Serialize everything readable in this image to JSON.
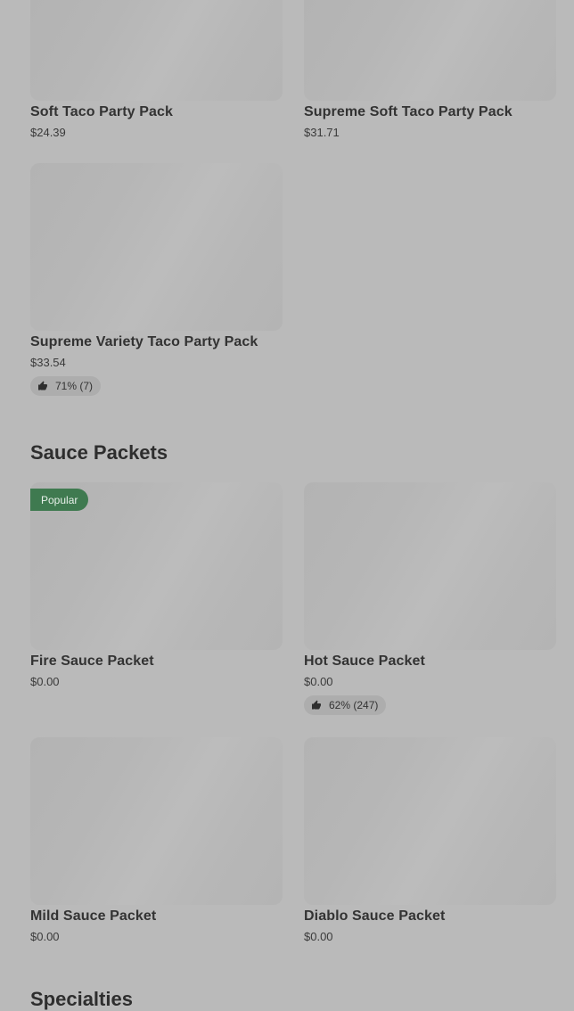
{
  "party_packs": {
    "items": [
      {
        "name": "Soft Taco Party Pack",
        "price": "$24.39"
      },
      {
        "name": "Supreme Soft Taco Party Pack",
        "price": "$31.71"
      },
      {
        "name": "Supreme Variety Taco Party Pack",
        "price": "$33.54",
        "rating": "71% (7)"
      }
    ]
  },
  "sauce_packets": {
    "title": "Sauce Packets",
    "items": [
      {
        "name": "Fire Sauce Packet",
        "price": "$0.00",
        "badge": "Popular"
      },
      {
        "name": "Hot Sauce Packet",
        "price": "$0.00",
        "rating": "62% (247)"
      },
      {
        "name": "Mild Sauce Packet",
        "price": "$0.00"
      },
      {
        "name": "Diablo Sauce Packet",
        "price": "$0.00"
      }
    ]
  },
  "specialties": {
    "title": "Specialties"
  },
  "icons": {
    "rating": "thumbs-up-icon"
  },
  "colors": {
    "badge_bg": "#3f7a50",
    "background": "#bababa"
  }
}
